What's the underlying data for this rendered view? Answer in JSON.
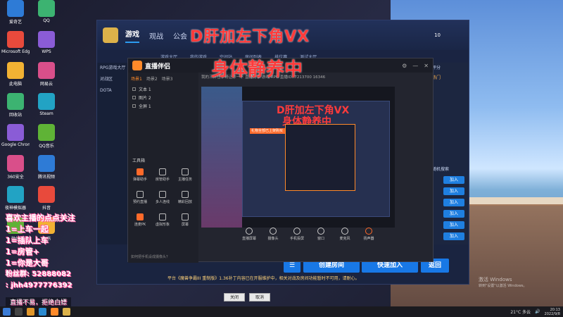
{
  "overlay": {
    "line1": "D肝加左下角VX",
    "line2": "身体静养中"
  },
  "game": {
    "tabs": [
      "游戏",
      "观战",
      "公会"
    ],
    "subnav": [
      "游戏大厅",
      "我的游戏",
      "空间站",
      "房间列表",
      "排位赛",
      "测试大厅"
    ],
    "sidebar": [
      "RPG游戏大厅",
      "对战区",
      "DOTA"
    ],
    "right_panel": [
      "评分",
      "热门",
      "随机搜索",
      "加入",
      "加入",
      "加入",
      "加入",
      "加入",
      "加入"
    ],
    "coins": "10",
    "buttons": {
      "create": "创建房间",
      "quick": "快速加入",
      "back": "返回"
    },
    "notice": "平台《魔兽争霸III 重制版》1.36补丁内容已在开服维护中，相关对战及房间功能暂时不可用，请耐心。"
  },
  "live": {
    "title": "直播伴侣",
    "meta": "我的三界任宁哥让你一下   直播分享   游戏 RPG   直播ID: 7213700   16346",
    "source_tabs": [
      "场景1",
      "场景2",
      "场景3"
    ],
    "sources": [
      "文本 1",
      "图片 2",
      "全屏 1"
    ],
    "tools_label": "工具箱",
    "tools": [
      "弹幕助手",
      "房管助手",
      "主播任务",
      "预约直播",
      "多人连线",
      "精彩回放",
      "连麦PK",
      "虚拟形象",
      "屏幕"
    ],
    "toolbar": [
      "直播屏幕",
      "摄像头",
      "手机投屏",
      "窗口",
      "麦克风",
      "扬声器"
    ],
    "footer": "如何把手机设成摄像头？",
    "preview_bar": "礼物全部已上架购买"
  },
  "promo": {
    "title": "喜欢主播的点点关注",
    "lines": [
      "1=上车一起",
      "1=插队上车",
      "1=房管+",
      "1=你是大哥"
    ],
    "fans": "粉丝群: 52888082",
    "wechat": ": jhh4977776392 ",
    "banner": "直播不易，拒绝白嫖"
  },
  "dialog": {
    "close": "关闭",
    "cancel": "取消"
  },
  "windows": {
    "activate_title": "激活 Windows",
    "activate_sub": "转到\"设置\"以激活 Windows。"
  },
  "tray": {
    "weather": "21°C 多云",
    "time": "20:13",
    "date": "2022/9/8"
  },
  "desktop": {
    "col1": [
      "爱奇艺",
      "Microsoft Edge",
      "此电脑",
      "回收站",
      "Google Chrome",
      "360安全",
      "夜神模拟器",
      "微信"
    ],
    "col2": [
      "QQ",
      "WPS",
      "网易云",
      "Steam",
      "QQ音乐",
      "腾讯视频",
      "抖音",
      "飞书"
    ]
  }
}
